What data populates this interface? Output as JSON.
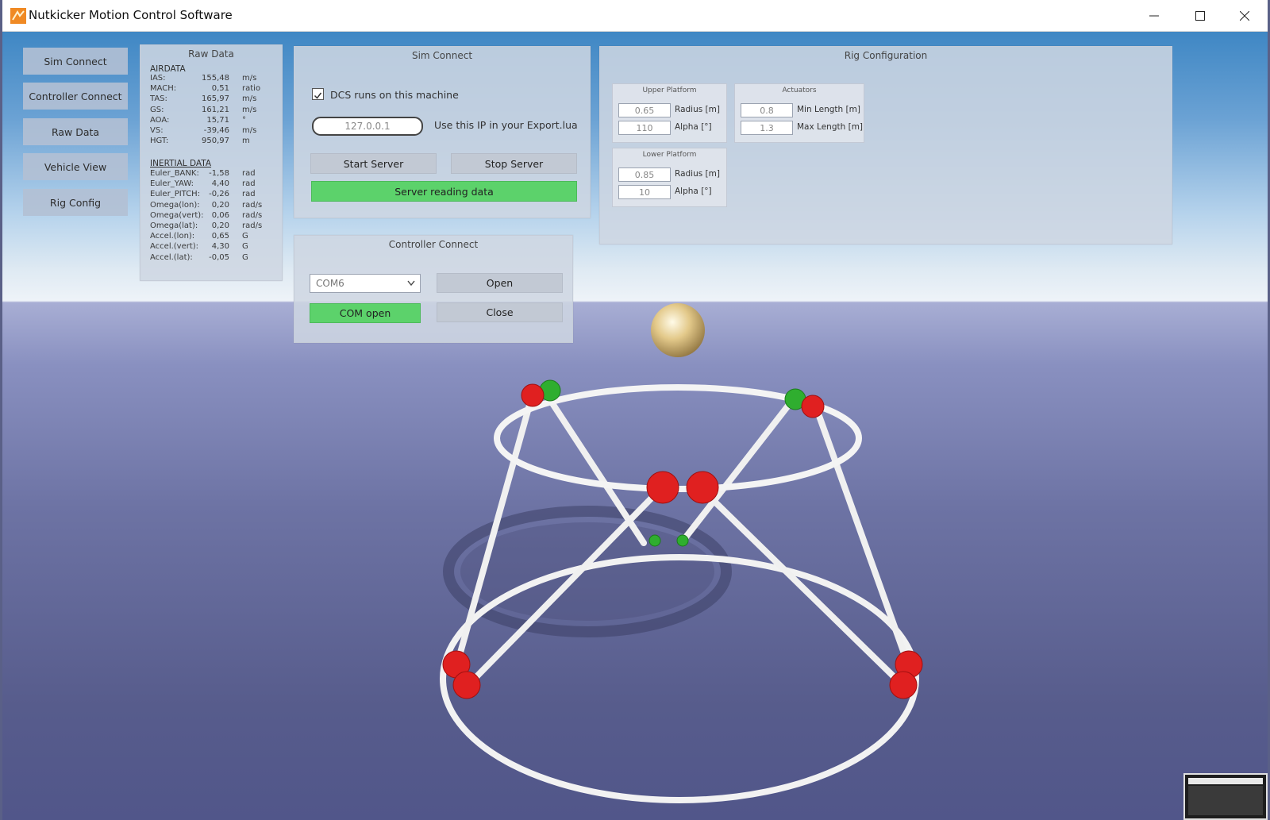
{
  "window": {
    "title": "Nutkicker Motion Control Software"
  },
  "nav": {
    "items": [
      {
        "label": "Sim Connect"
      },
      {
        "label": "Controller Connect"
      },
      {
        "label": "Raw Data"
      },
      {
        "label": "Vehicle View"
      },
      {
        "label": "Rig Config"
      }
    ]
  },
  "raw_data": {
    "title": "Raw Data",
    "airdata_header": "AIRDATA",
    "airdata": [
      {
        "name": "IAS:",
        "value": "155,48",
        "unit": "m/s"
      },
      {
        "name": "MACH:",
        "value": "0,51",
        "unit": "ratio"
      },
      {
        "name": "TAS:",
        "value": "165,97",
        "unit": "m/s"
      },
      {
        "name": "GS:",
        "value": "161,21",
        "unit": "m/s"
      },
      {
        "name": "AOA:",
        "value": "15,71",
        "unit": "°"
      },
      {
        "name": "VS:",
        "value": "-39,46",
        "unit": "m/s"
      },
      {
        "name": "HGT:",
        "value": "950,97",
        "unit": "m"
      }
    ],
    "inertial_header": "INERTIAL DATA",
    "inertial": [
      {
        "name": "Euler_BANK:",
        "value": "-1,58",
        "unit": "rad"
      },
      {
        "name": "Euler_YAW:",
        "value": "4,40",
        "unit": "rad"
      },
      {
        "name": "Euler_PITCH:",
        "value": "-0,26",
        "unit": "rad"
      },
      {
        "name": "Omega(lon):",
        "value": "0,20",
        "unit": "rad/s"
      },
      {
        "name": "Omega(vert):",
        "value": "0,06",
        "unit": "rad/s"
      },
      {
        "name": "Omega(lat):",
        "value": "0,20",
        "unit": "rad/s"
      },
      {
        "name": "Accel.(lon):",
        "value": "0,65",
        "unit": "G"
      },
      {
        "name": "Accel.(vert):",
        "value": "4,30",
        "unit": "G"
      },
      {
        "name": "Accel.(lat):",
        "value": "-0,05",
        "unit": "G"
      }
    ]
  },
  "sim_connect": {
    "title": "Sim Connect",
    "checkbox_label": "DCS runs on this machine",
    "checked": true,
    "ip_value": "127.0.0.1",
    "ip_hint": "Use this IP in your Export.lua",
    "start_label": "Start Server",
    "stop_label": "Stop Server",
    "status": "Server reading data",
    "status_color": "#5cd26b"
  },
  "controller_connect": {
    "title": "Controller Connect",
    "port": "COM6",
    "open_label": "Open",
    "close_label": "Close",
    "status": "COM open",
    "status_color": "#5cd26b"
  },
  "rig_config": {
    "title": "Rig Configuration",
    "upper_platform": {
      "title": "Upper Platform",
      "radius": "0.65",
      "radius_label": "Radius [m]",
      "alpha": "110",
      "alpha_label": "Alpha [°]"
    },
    "actuators": {
      "title": "Actuators",
      "min": "0.8",
      "min_label": "Min Length [m]",
      "max": "1.3",
      "max_label": "Max Length [m]"
    },
    "lower_platform": {
      "title": "Lower Platform",
      "radius": "0.85",
      "radius_label": "Radius [m]",
      "alpha": "10",
      "alpha_label": "Alpha [°]"
    }
  },
  "scene": {
    "joint_red": "#e02020",
    "joint_green": "#2fae2f",
    "ball": "#e3c98a"
  }
}
